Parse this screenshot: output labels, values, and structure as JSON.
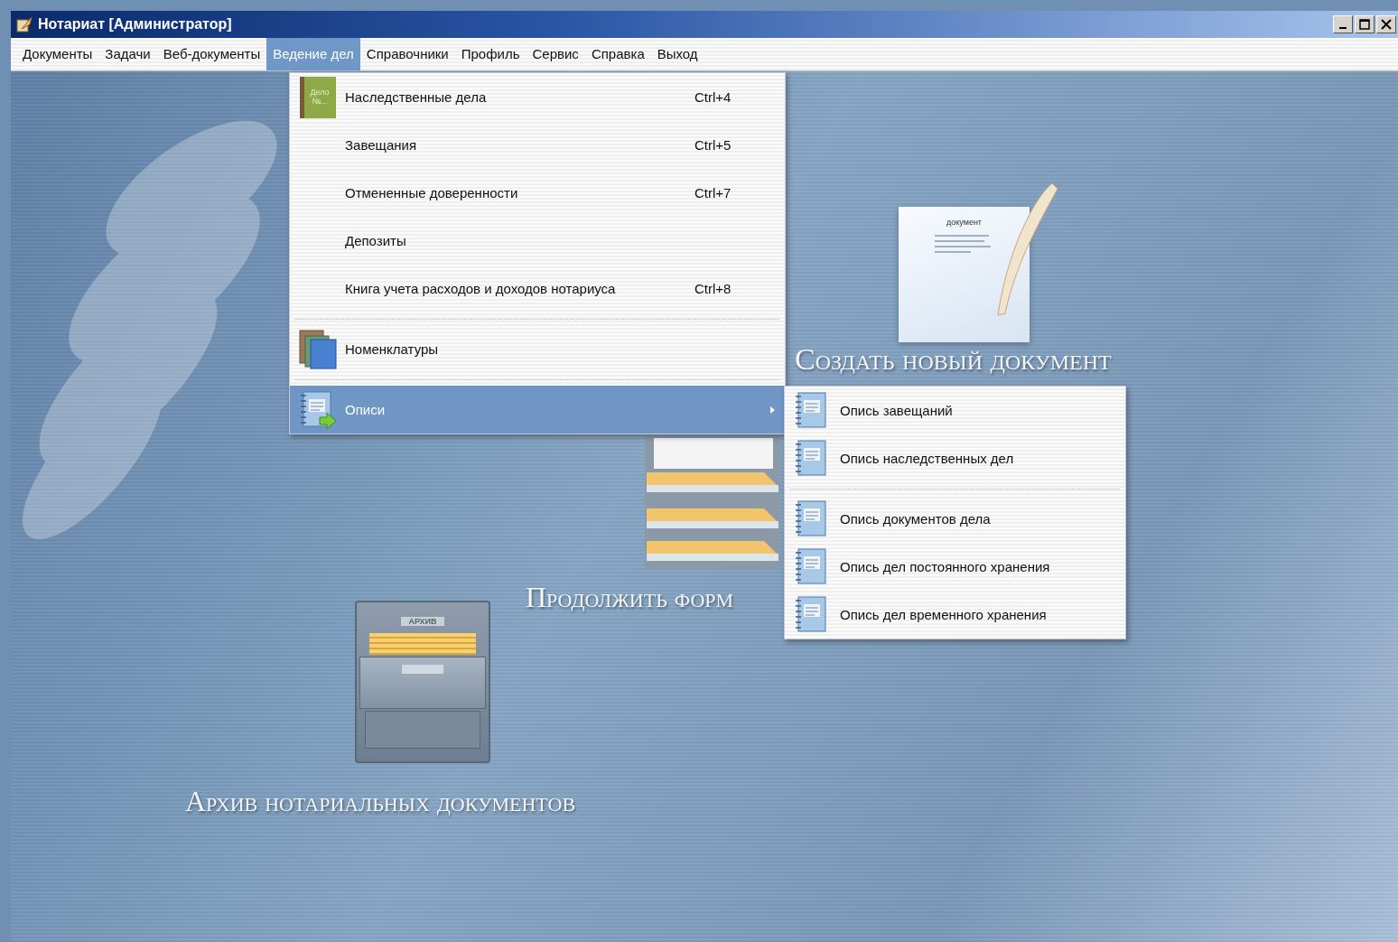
{
  "window": {
    "title": "Нотариат [Администратор]"
  },
  "menu_bar": [
    {
      "label": "Документы",
      "selected": false
    },
    {
      "label": "Задачи",
      "selected": false
    },
    {
      "label": "Веб-документы",
      "selected": false
    },
    {
      "label": "Ведение дел",
      "selected": true
    },
    {
      "label": "Справочники",
      "selected": false
    },
    {
      "label": "Профиль",
      "selected": false
    },
    {
      "label": "Сервис",
      "selected": false
    },
    {
      "label": "Справка",
      "selected": false
    },
    {
      "label": "Выход",
      "selected": false
    }
  ],
  "dropdown": [
    {
      "kind": "item",
      "icon_text": "Дело №...",
      "label": "Наследственные дела",
      "shortcut": "Ctrl+4",
      "selected": false
    },
    {
      "kind": "item",
      "label": "Завещания",
      "shortcut": "Ctrl+5",
      "selected": false
    },
    {
      "kind": "item",
      "label": "Отмененные доверенности",
      "shortcut": "Ctrl+7",
      "selected": false
    },
    {
      "kind": "item",
      "label": "Депозиты",
      "selected": false
    },
    {
      "kind": "item",
      "label": "Книга учета расходов и доходов нотариуса",
      "shortcut": "Ctrl+8",
      "selected": false
    },
    {
      "kind": "separator"
    },
    {
      "kind": "books",
      "label": "Номенклатуры",
      "selected": false
    },
    {
      "kind": "separator"
    },
    {
      "kind": "submenu",
      "label": "Описи",
      "selected": true
    }
  ],
  "submenu": [
    {
      "kind": "item",
      "label": "Опись завещаний"
    },
    {
      "kind": "item",
      "label": "Опись наследственных дел"
    },
    {
      "kind": "separator"
    },
    {
      "kind": "item",
      "label": "Опись документов дела"
    },
    {
      "kind": "item",
      "label": "Опись дел постоянного хранения"
    },
    {
      "kind": "item",
      "label": "Опись дел временного хранения"
    }
  ],
  "desktop": {
    "new_document": {
      "label": "Создать новый документ",
      "icon_text": "документ"
    },
    "continue": {
      "label": "Продолжить форм"
    },
    "archive": {
      "label": "Архив нотариальных документов",
      "icon_text": "АРХИВ"
    }
  }
}
